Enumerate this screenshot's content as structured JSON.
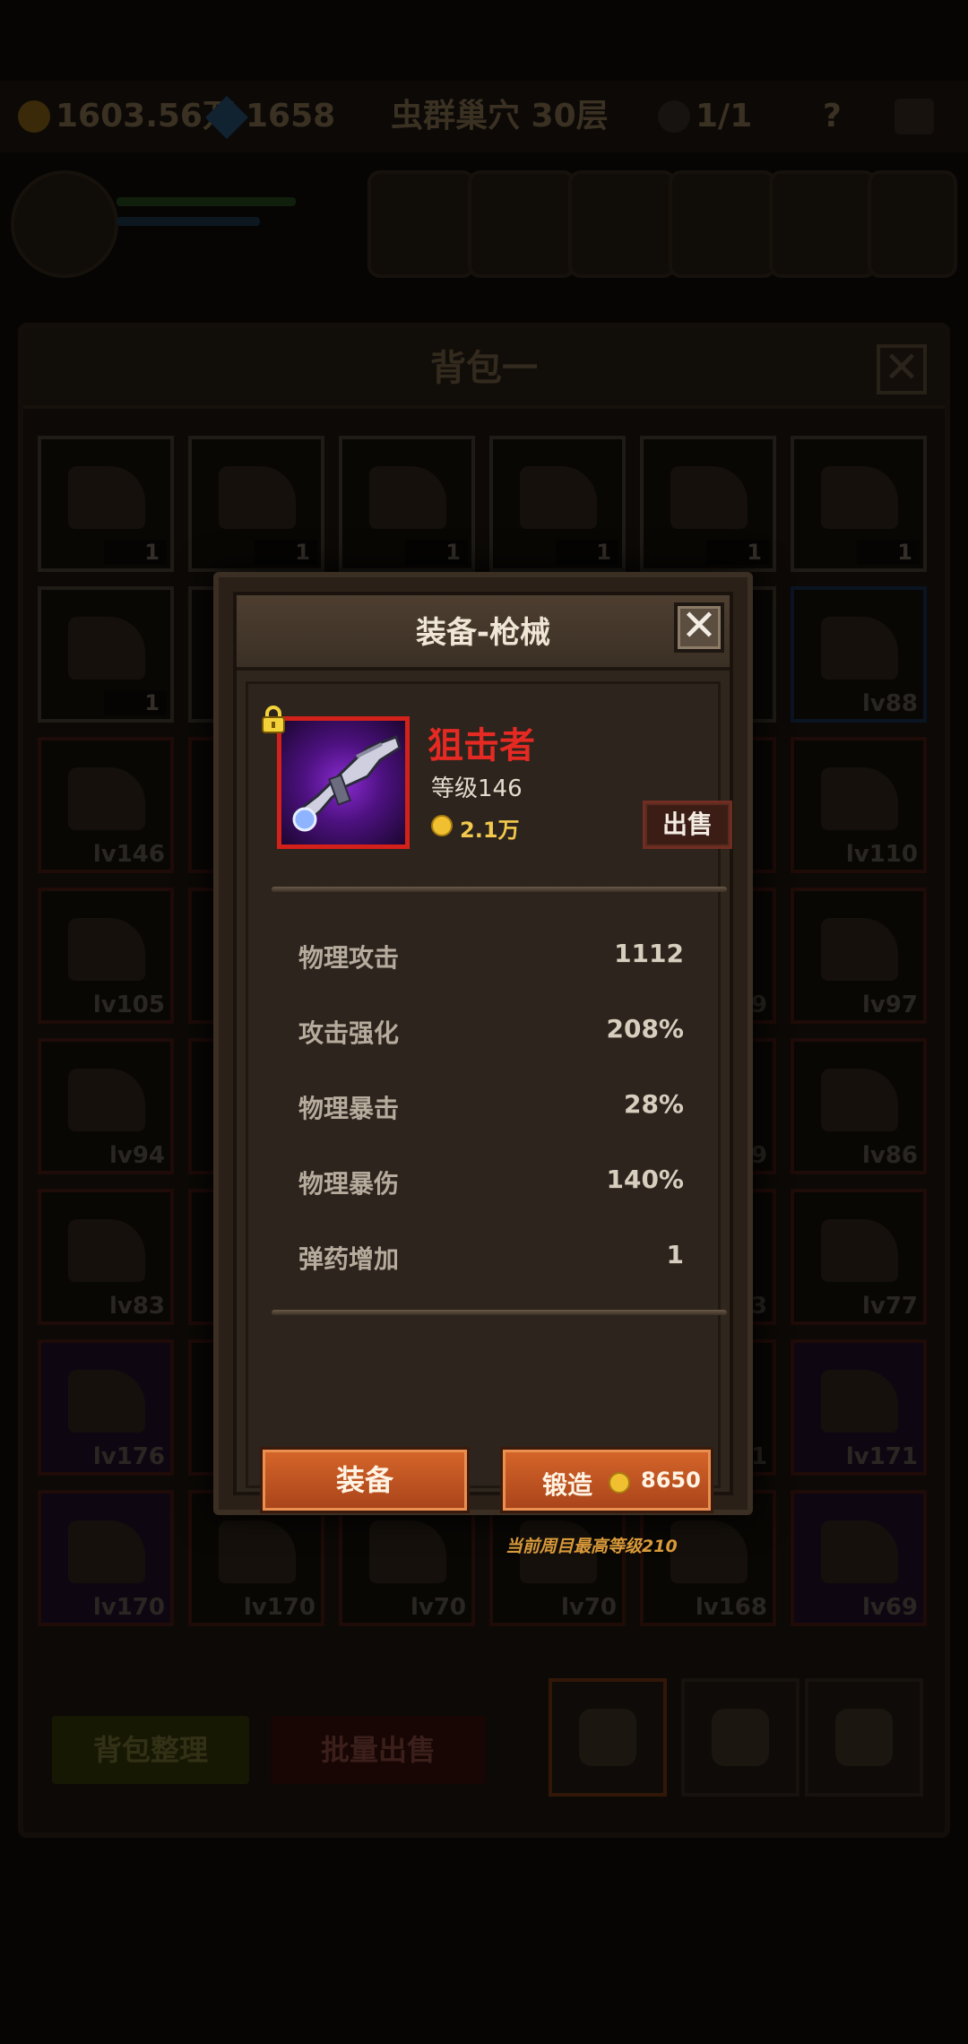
{
  "topbar": {
    "gold": "1603.56万",
    "gems": "1658",
    "stage": "虫群巢穴 30层",
    "skull_count": "1/1",
    "help": "?"
  },
  "bag": {
    "title": "背包一",
    "close": "✕",
    "rows": [
      [
        {
          "t": "1"
        },
        {
          "t": "1"
        },
        {
          "t": "1"
        },
        {
          "t": "1"
        },
        {
          "t": "1"
        },
        {
          "t": "1"
        }
      ],
      [
        {
          "t": "1"
        },
        {
          "t": ""
        },
        {
          "t": ""
        },
        {
          "t": ""
        },
        {
          "t": ""
        },
        {
          "t": "lv88"
        }
      ],
      [
        {
          "t": "lv146"
        },
        {
          "t": ""
        },
        {
          "t": ""
        },
        {
          "t": ""
        },
        {
          "t": ""
        },
        {
          "t": "lv110"
        }
      ],
      [
        {
          "t": "lv105"
        },
        {
          "t": ""
        },
        {
          "t": ""
        },
        {
          "t": ""
        },
        {
          "t": "9"
        },
        {
          "t": "lv97"
        }
      ],
      [
        {
          "t": "lv94"
        },
        {
          "t": ""
        },
        {
          "t": ""
        },
        {
          "t": ""
        },
        {
          "t": "9"
        },
        {
          "t": "lv86"
        }
      ],
      [
        {
          "t": "lv83"
        },
        {
          "t": ""
        },
        {
          "t": ""
        },
        {
          "t": ""
        },
        {
          "t": "3"
        },
        {
          "t": "lv77"
        }
      ],
      [
        {
          "t": "lv176"
        },
        {
          "t": ""
        },
        {
          "t": ""
        },
        {
          "t": ""
        },
        {
          "t": "1"
        },
        {
          "t": "lv171"
        }
      ],
      [
        {
          "t": "lv170"
        },
        {
          "t": "lv170"
        },
        {
          "t": "lv70"
        },
        {
          "t": "lv70"
        },
        {
          "t": "lv168"
        },
        {
          "t": "lv69"
        }
      ]
    ],
    "sort_button": "背包整理",
    "batch_sell_button": "批量出售"
  },
  "modal": {
    "title": "装备-枪械",
    "close": "✕",
    "item": {
      "name": "狙击者",
      "level": "等级146",
      "price": "2.1万",
      "sell_button": "出售"
    },
    "stats": [
      {
        "label": "物理攻击",
        "value": "1112"
      },
      {
        "label": "攻击强化",
        "value": "208%"
      },
      {
        "label": "物理暴击",
        "value": "28%"
      },
      {
        "label": "物理暴伤",
        "value": "140%"
      },
      {
        "label": "弹药增加",
        "value": "1"
      }
    ],
    "equip_button": "装备",
    "forge_button": "锻造",
    "forge_cost": "8650",
    "max_level_note": "当前周目最高等级210"
  },
  "colors": {
    "accent_orange": "#c2541f",
    "item_name_red": "#e42a22",
    "rarity_border": "#d2201a",
    "gold": "#f2c94c"
  }
}
